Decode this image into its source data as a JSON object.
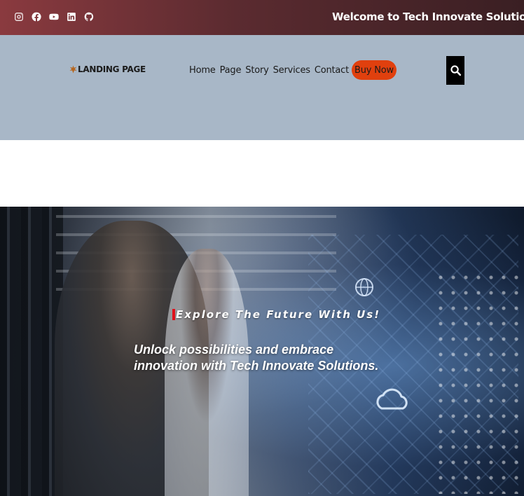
{
  "topbar": {
    "social_icons": [
      "instagram-icon",
      "facebook-icon",
      "youtube-icon",
      "linkedin-icon",
      "github-icon"
    ],
    "welcome_text": "Welcome to Tech Innovate Solutions"
  },
  "header": {
    "logo_text": "LANDING PAGE",
    "nav": [
      "Home",
      "Page",
      "Story",
      "Services",
      "Contact"
    ],
    "cta_label": "Buy Now",
    "search_icon": "search-icon"
  },
  "hero": {
    "eyebrow": "Explore The Future With Us!",
    "tagline_line1": "Unlock possibilities and embrace",
    "tagline_line2": "innovation with Tech Innovate Solutions."
  },
  "colors": {
    "topbar_start": "#8a3a3f",
    "topbar_end": "#3a1f23",
    "header_bg": "#a8b7c7",
    "cta_bg": "#e0400e",
    "eyebrow_accent": "#e0101a"
  }
}
